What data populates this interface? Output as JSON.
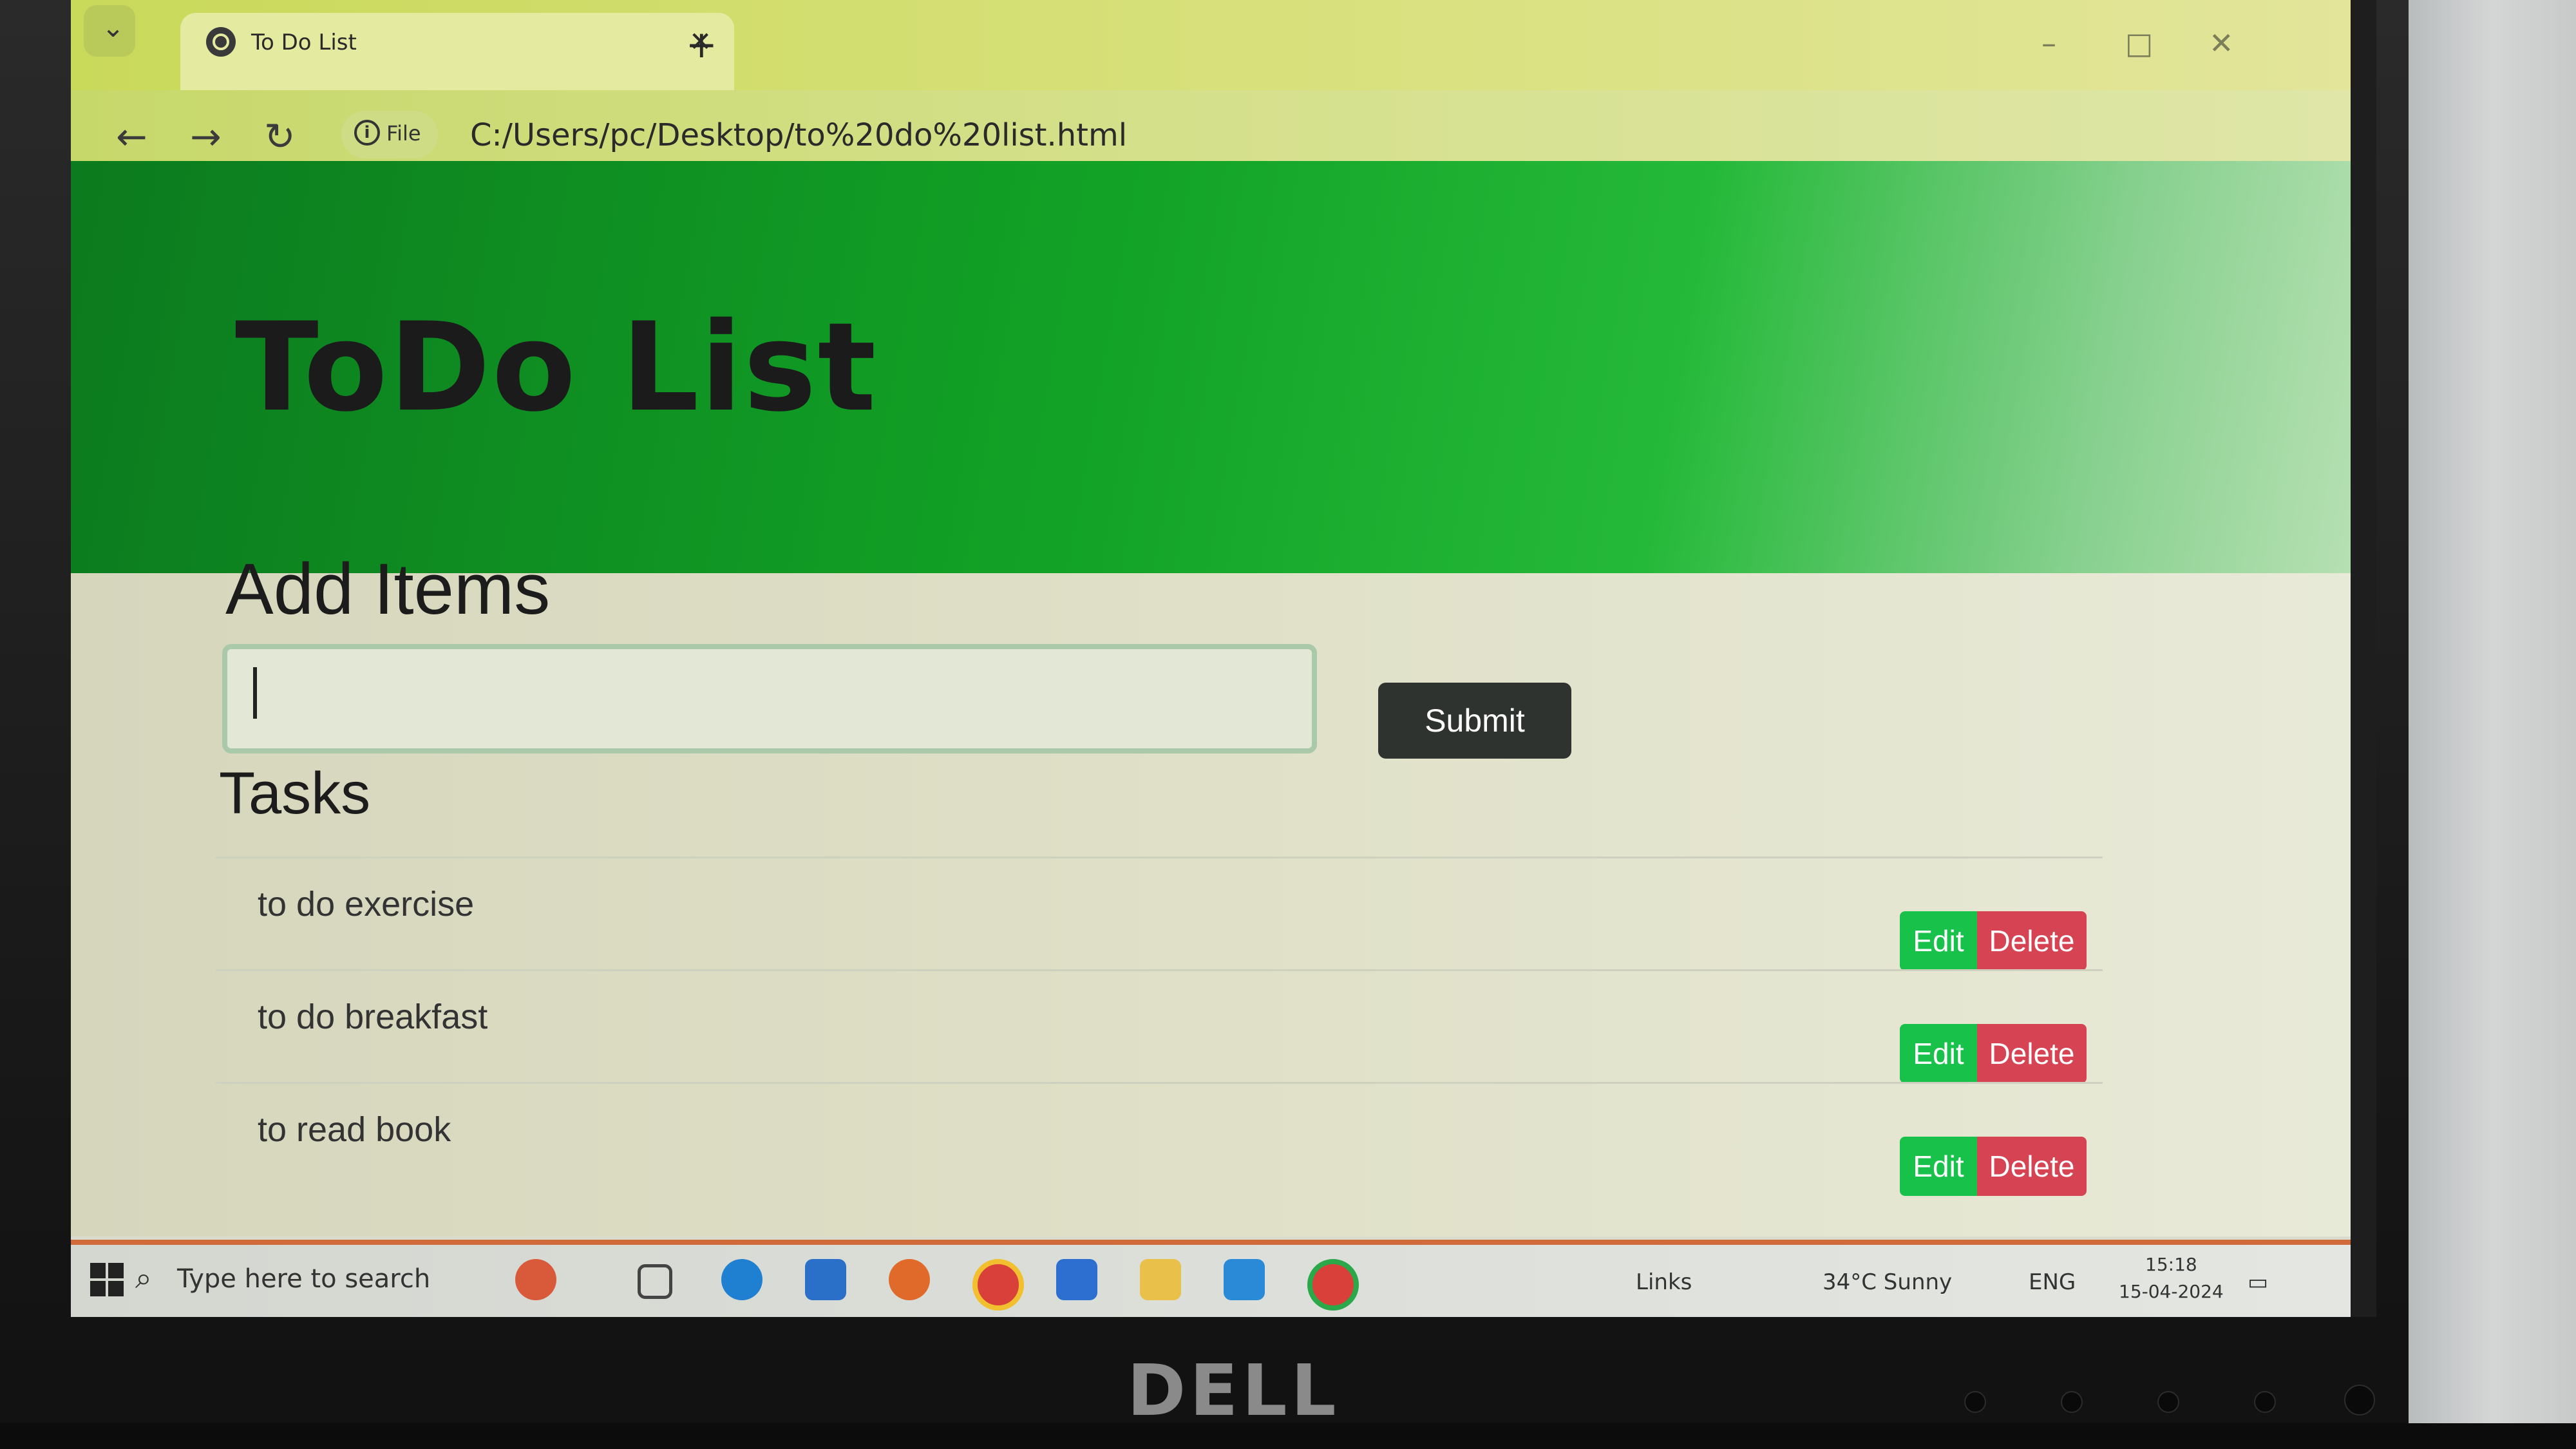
{
  "browser": {
    "tab_title": "To Do List",
    "tab_close": "✕",
    "new_tab": "+",
    "info_label": "File",
    "url": "C:/Users/pc/Desktop/to%20do%20list.html"
  },
  "page": {
    "title": "ToDo List",
    "add_heading": "Add Items",
    "submit_label": "Submit",
    "tasks_heading": "Tasks",
    "tasks": [
      {
        "text": "to do exercise",
        "edit": "Edit",
        "delete": "Delete"
      },
      {
        "text": "to do breakfast",
        "edit": "Edit",
        "delete": "Delete"
      },
      {
        "text": "to read book",
        "edit": "Edit",
        "delete": "Delete"
      }
    ]
  },
  "taskbar": {
    "search_placeholder": "Type here to search",
    "links": "Links",
    "weather": "34°C  Sunny",
    "lang": "ENG",
    "time": "15:18",
    "date": "15-04-2024"
  },
  "monitor": {
    "brand": "DELL"
  },
  "colors": {
    "edit": "#18c24a",
    "delete": "#d64454",
    "submit": "#2f332f",
    "header": "#12a326"
  }
}
